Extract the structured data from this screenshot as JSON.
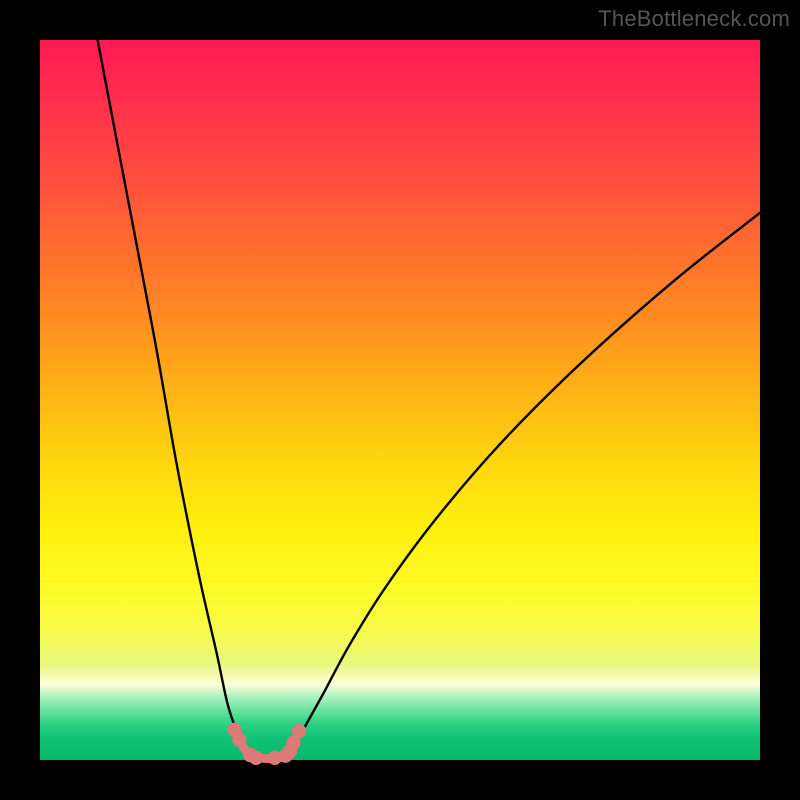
{
  "watermark": "TheBottleneck.com",
  "chart_data": {
    "type": "line",
    "title": "",
    "xlabel": "",
    "ylabel": "",
    "xlim": [
      0,
      100
    ],
    "ylim": [
      0,
      100
    ],
    "grid": false,
    "legend": false,
    "series": [
      {
        "name": "left-curve",
        "x": [
          8,
          12,
          16,
          19,
          22,
          24.5,
          26,
          27.3,
          28.2,
          29.3
        ],
        "values": [
          100,
          79,
          58,
          41,
          26,
          15,
          8,
          4,
          1.8,
          0.5
        ]
      },
      {
        "name": "right-curve",
        "x": [
          34.3,
          35.4,
          37,
          39.5,
          43,
          48,
          55,
          64,
          75,
          88,
          100
        ],
        "values": [
          0.5,
          2.2,
          5,
          9.5,
          16,
          24,
          33.5,
          44,
          55,
          66.5,
          76
        ]
      },
      {
        "name": "bottom-trough",
        "x": [
          29.3,
          31.8,
          34.3
        ],
        "values": [
          0.5,
          0.2,
          0.5
        ]
      }
    ],
    "markers": {
      "name": "highlighted-points",
      "color": "#dd7a78",
      "points": [
        {
          "x": 27.0,
          "y": 4.2
        },
        {
          "x": 27.7,
          "y": 2.8
        },
        {
          "x": 29.2,
          "y": 0.7
        },
        {
          "x": 30.0,
          "y": 0.3
        },
        {
          "x": 32.6,
          "y": 0.3
        },
        {
          "x": 34.1,
          "y": 0.6
        },
        {
          "x": 34.7,
          "y": 1.2
        },
        {
          "x": 35.2,
          "y": 2.4
        },
        {
          "x": 36.0,
          "y": 4.0
        }
      ]
    },
    "background_gradient": {
      "top": "#ff1a53",
      "mid": "#fff00d",
      "bottom": "#05b96b"
    }
  }
}
